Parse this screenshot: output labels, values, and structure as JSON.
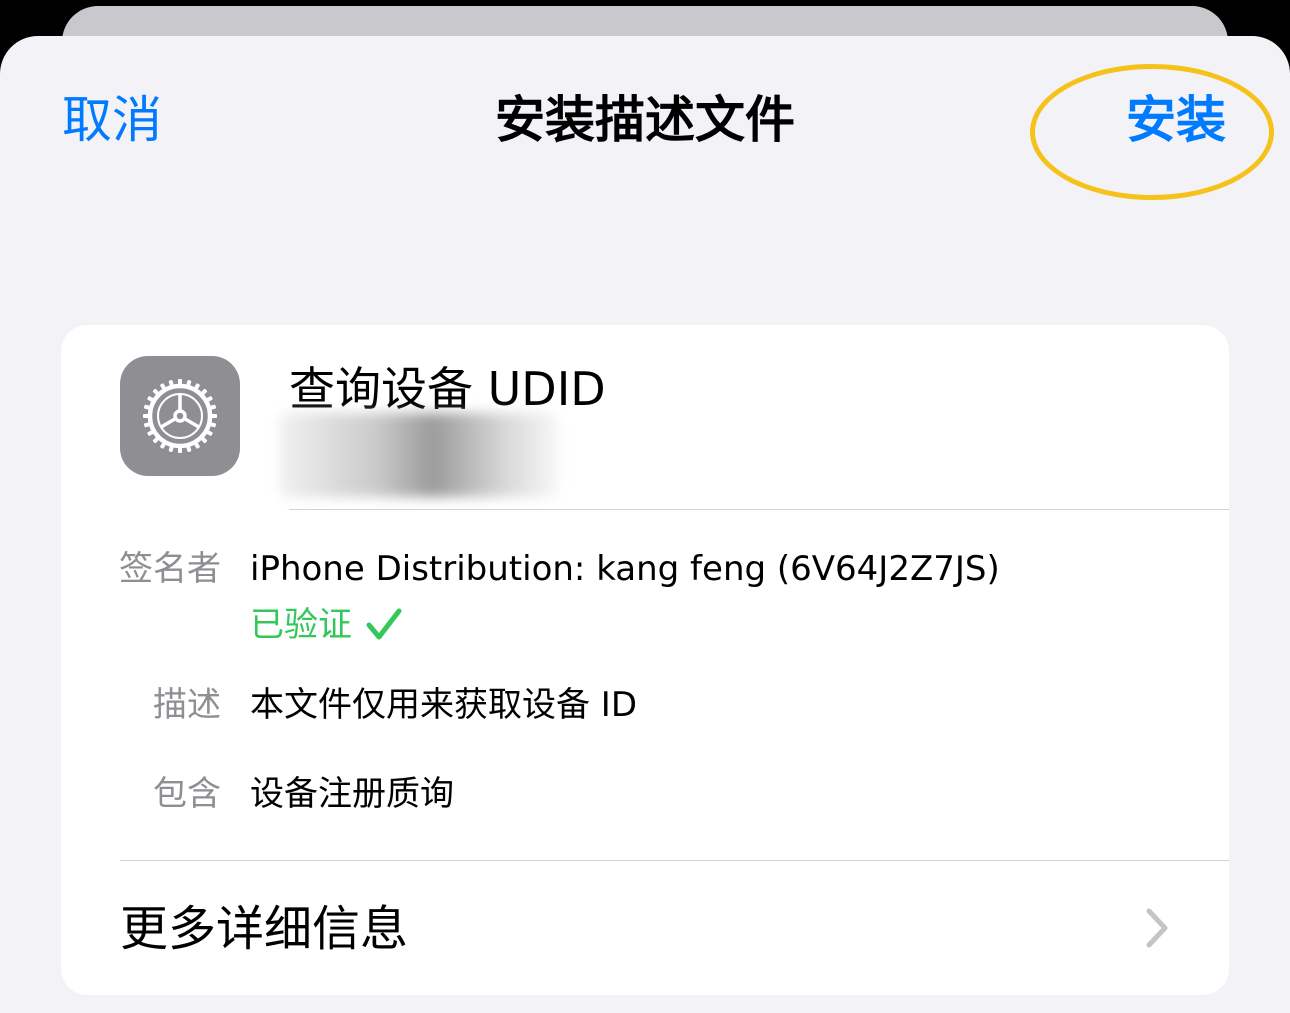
{
  "nav": {
    "cancel_label": "取消",
    "title": "安装描述文件",
    "install_label": "安装"
  },
  "profile": {
    "name": "查询设备 UDID",
    "icon": "gear-icon"
  },
  "details": {
    "signer_label": "签名者",
    "signer_value": "iPhone Distribution: kang feng (6V64J2Z7JS)",
    "verified_label": "已验证",
    "description_label": "描述",
    "description_value": "本文件仅用来获取设备 ID",
    "contains_label": "包含",
    "contains_value": "设备注册质询"
  },
  "more": {
    "label": "更多详细信息",
    "icon": "chevron-right-icon"
  },
  "colors": {
    "accent": "#007aff",
    "verified": "#34c759",
    "highlight": "#f6c21a",
    "icon_bg": "#8e8e93"
  }
}
